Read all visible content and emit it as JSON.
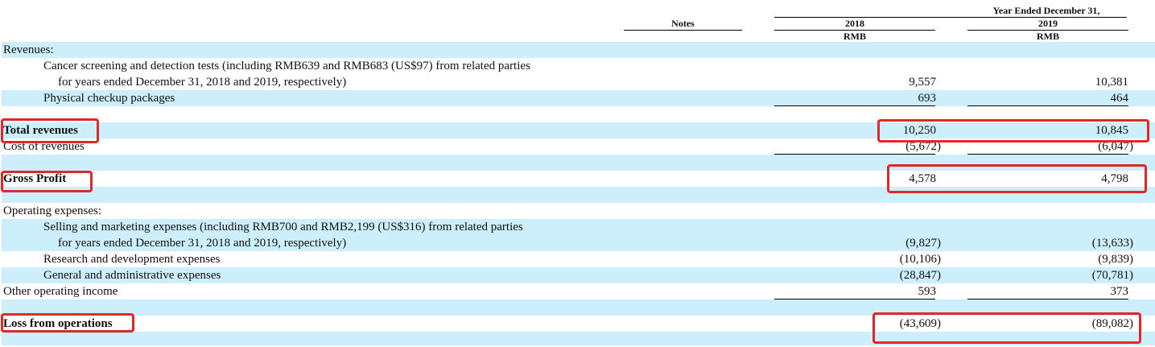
{
  "header": {
    "notes": "Notes",
    "period": "Year Ended December 31,",
    "col_2018": "2018",
    "col_2019": "2019",
    "currency_2018": "RMB",
    "currency_2019": "RMB"
  },
  "rows": [
    {
      "label": "Revenues:",
      "v2018": "",
      "v2019": ""
    },
    {
      "label": "Cancer screening and detection tests (including RMB639 and RMB683 (US$97) from related parties",
      "v2018": "",
      "v2019": ""
    },
    {
      "label": "for years ended December 31, 2018 and 2019, respectively)",
      "v2018": "9,557",
      "v2019": "10,381"
    },
    {
      "label": "Physical checkup packages",
      "v2018": "693",
      "v2019": "464"
    },
    {
      "label": "",
      "v2018": "",
      "v2019": ""
    },
    {
      "label": "Total revenues",
      "v2018": "10,250",
      "v2019": "10,845"
    },
    {
      "label": "Cost of revenues",
      "v2018": "(5,672)",
      "v2019": "(6,047)"
    },
    {
      "label": "",
      "v2018": "",
      "v2019": ""
    },
    {
      "label": "Gross Profit",
      "v2018": "4,578",
      "v2019": "4,798"
    },
    {
      "label": "",
      "v2018": "",
      "v2019": ""
    },
    {
      "label": "Operating expenses:",
      "v2018": "",
      "v2019": ""
    },
    {
      "label": "Selling and marketing expenses (including RMB700 and RMB2,199 (US$316) from related parties",
      "v2018": "",
      "v2019": ""
    },
    {
      "label": "for years ended December 31, 2018 and 2019, respectively)",
      "v2018": "(9,827)",
      "v2019": "(13,633)"
    },
    {
      "label": "Research and development expenses",
      "v2018": "(10,106)",
      "v2019": "(9,839)"
    },
    {
      "label": "General and administrative expenses",
      "v2018": "(28,847)",
      "v2019": "(70,781)"
    },
    {
      "label": "Other operating income",
      "v2018": "593",
      "v2019": "373"
    },
    {
      "label": "",
      "v2018": "",
      "v2019": ""
    },
    {
      "label": "Loss from operations",
      "v2018": "(43,609)",
      "v2019": "(89,082)"
    },
    {
      "label": "",
      "v2018": "",
      "v2019": ""
    }
  ],
  "annotation_color": "#e32626",
  "row_shade_color": "#cdeefb"
}
